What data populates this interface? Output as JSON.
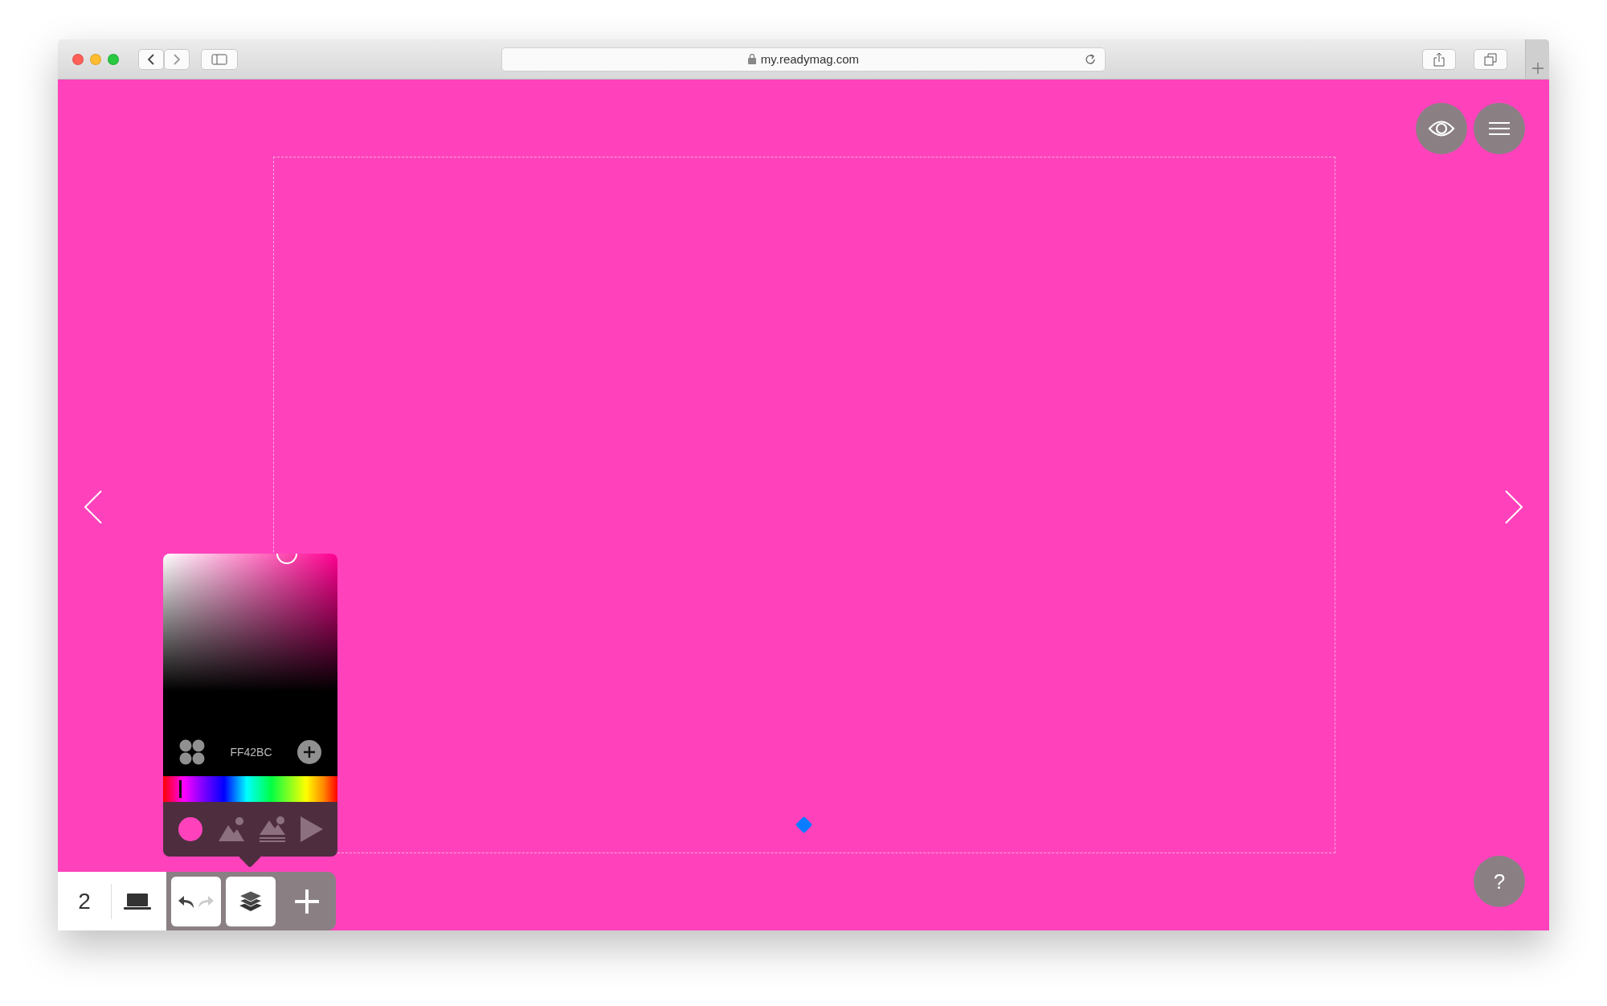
{
  "browser": {
    "url": "my.readymag.com"
  },
  "page_number": "2",
  "color_picker": {
    "hex": "FF42BC",
    "hue_slider": {
      "level": 0.09
    },
    "fill_types": [
      {
        "kind": "color",
        "selected": true
      },
      {
        "kind": "image",
        "selected": false
      },
      {
        "kind": "parallax",
        "selected": false
      },
      {
        "kind": "video",
        "selected": false
      }
    ]
  },
  "history": {
    "undo": {
      "disabled": false
    },
    "redo": {
      "disabled": true
    }
  },
  "help": {
    "label": "?"
  }
}
